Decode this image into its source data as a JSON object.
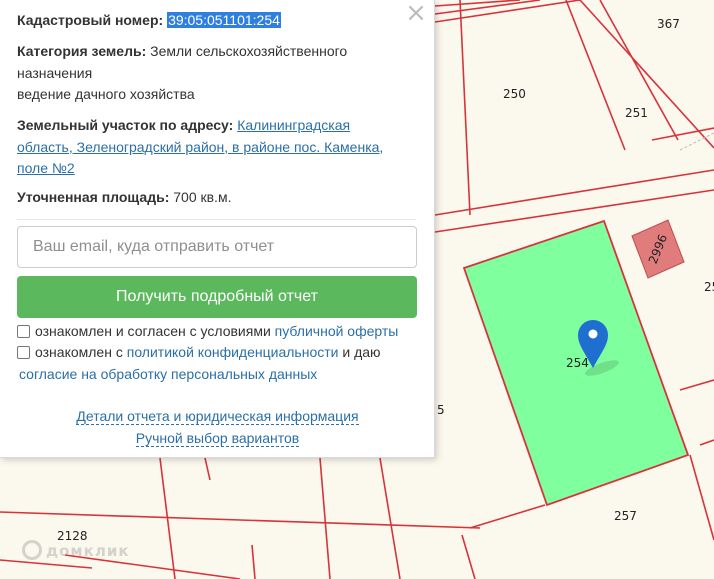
{
  "popup": {
    "cadastral_label": "Кадастровый номер:",
    "cadastral_number": "39:05:051101:254",
    "category_label": "Категория земель:",
    "category_line1": "Земли сельскохозяйственного",
    "category_line2": "назначения",
    "category_line3": "ведение дачного хозяйства",
    "address_label": "Земельный участок по адресу:",
    "address_link_1": "Калининградская",
    "address_link_2": "область, Зеленоградский район, в районе пос. Каменка,",
    "address_link_3": "поле №2",
    "area_label": "Уточненная площадь:",
    "area_value": "700 кв.м.",
    "email_placeholder": "Ваш email, куда отправить отчет",
    "report_button": "Получить подробный отчет",
    "consent1_text": "ознакомлен и согласен с условиями",
    "consent1_link": "публичной оферты",
    "consent2_text_a": "ознакомлен с",
    "consent2_link_a": "политикой конфиденциальности",
    "consent2_text_b": "и даю",
    "consent2_link_b": "согласие на обработку персональных данных",
    "details_link": "Детали отчета и юридическая информация",
    "manual_link": "Ручной выбор вариантов",
    "close_icon": "×"
  },
  "map": {
    "labels": {
      "p367": "367",
      "p250": "250",
      "p251": "251",
      "p2996": "2996",
      "p25": "25",
      "p254": "254",
      "p5": "5",
      "p257": "257",
      "p2128": "2128"
    },
    "watermark": "домклик",
    "colors": {
      "boundary": "#d8333b",
      "selected_fill": "#80ff9f",
      "building_fill": "#e07c7c",
      "pin": "#1f6fd0"
    }
  }
}
